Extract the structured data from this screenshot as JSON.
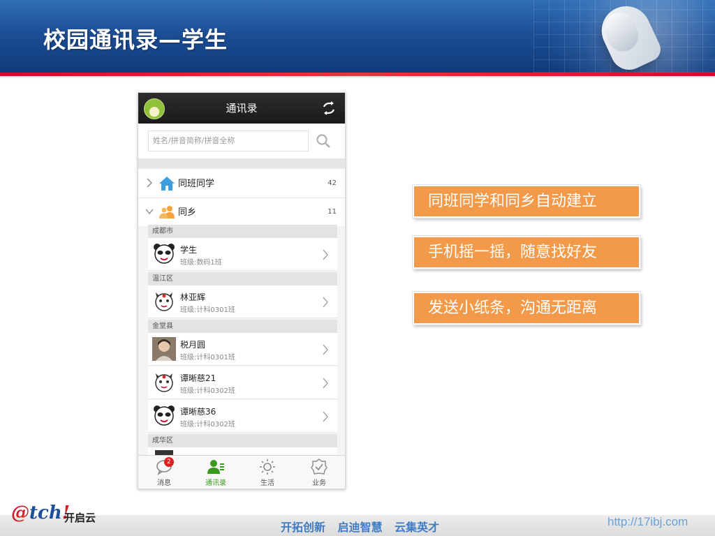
{
  "slide": {
    "title": "校园通讯录—学生"
  },
  "app": {
    "title": "通讯录",
    "search_placeholder": "姓名/拼音简称/拼音全称",
    "groups": [
      {
        "label": "同班同学",
        "count": "42",
        "icon": "home-icon",
        "expanded": false
      },
      {
        "label": "同乡",
        "count": "11",
        "icon": "people-icon",
        "expanded": true
      }
    ],
    "regions": [
      {
        "name": "成都市"
      },
      {
        "name": "温江区"
      },
      {
        "name": "金堂县"
      },
      {
        "name": "成华区"
      }
    ],
    "contacts": [
      {
        "name": "学生",
        "class": "班级:数码1班",
        "avatar": "panda-avatar"
      },
      {
        "name": "林亚辉",
        "class": "班级:计科0301班",
        "avatar": "cat-avatar"
      },
      {
        "name": "税月圆",
        "class": "班级:计科0301班",
        "avatar": "photo-avatar"
      },
      {
        "name": "谭晰慈21",
        "class": "班级:计科0302班",
        "avatar": "cat-avatar"
      },
      {
        "name": "谭晰慈36",
        "class": "班级:计科0302班",
        "avatar": "panda-avatar"
      }
    ],
    "tabs": [
      {
        "label": "消息",
        "icon": "chat-icon",
        "badge": "2"
      },
      {
        "label": "通讯录",
        "icon": "contacts-icon",
        "active": true
      },
      {
        "label": "生活",
        "icon": "sun-icon"
      },
      {
        "label": "业务",
        "icon": "shield-check-icon"
      }
    ]
  },
  "callouts": [
    "同班同学和同乡自动建立",
    "手机摇一摇，随意找好友",
    "发送小纸条，沟通无距离"
  ],
  "footer": {
    "brand_logo_a": "@",
    "brand_logo_b": "tch",
    "brand_logo_c": "!",
    "brand_name": "开启云",
    "slogan": "开拓创新 启迪智慧 云集英才",
    "url": "http://17ibj.com"
  },
  "colors": {
    "header_blue": "#1c4f96",
    "accent_red": "#c8102e",
    "callout_orange": "#f39a4a",
    "active_green": "#3a9a1e",
    "slogan_blue": "#3e7cc4"
  }
}
